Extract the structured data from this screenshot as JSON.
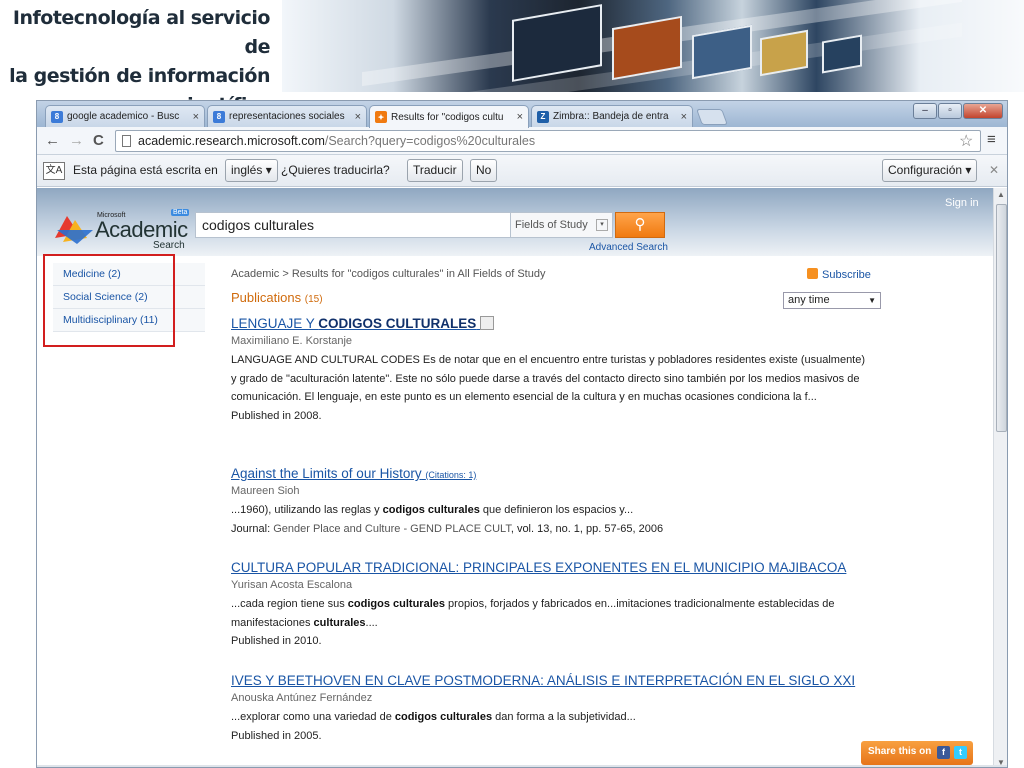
{
  "slide": {
    "title_line1": "Infotecnología al servicio de",
    "title_line2": "la gestión de información",
    "title_line3": "científica"
  },
  "browser": {
    "tabs": [
      {
        "label": "google academico - Busc",
        "icon": "google-favicon",
        "color": "#3c7bd8"
      },
      {
        "label": "representaciones sociales",
        "icon": "google-favicon",
        "color": "#3c7bd8"
      },
      {
        "label": "Results for \"codigos cultu",
        "icon": "academic-favicon",
        "color": "#f07a10"
      },
      {
        "label": "Zimbra:: Bandeja de entra",
        "icon": "zimbra-favicon",
        "color": "#1f5fa8"
      }
    ],
    "url_host": "academic.research.microsoft.com",
    "url_path": "/Search?query=codigos%20culturales"
  },
  "translate_bar": {
    "prefix": "Esta página está escrita en",
    "language": "inglés",
    "question": "¿Quieres traducirla?",
    "translate_button": "Traducir",
    "no_button": "No",
    "settings_button": "Configuración",
    "icon_text": "文A"
  },
  "site": {
    "sign_in": "Sign in",
    "logo_microsoft": "Microsoft",
    "logo_academic": "Academic",
    "logo_search": "Search",
    "logo_beta": "Beta",
    "search_value": "codigos culturales",
    "fields_label": "Fields of Study",
    "go_icon": "⚲",
    "advanced_search": "Advanced Search"
  },
  "leftnav": [
    {
      "label": "Medicine (2)"
    },
    {
      "label": "Social Science (2)"
    },
    {
      "label": "Multidisciplinary (11)"
    }
  ],
  "main": {
    "breadcrumb_root": "Academic",
    "breadcrumb_sep": ">",
    "breadcrumb_text": "Results for \"codigos culturales\" in All Fields of Study",
    "subscribe": "Subscribe",
    "publications_label": "Publications",
    "publications_count": "(15)",
    "time_filter": "any time"
  },
  "results": [
    {
      "title_a": "LENGUAJE Y ",
      "title_b": "CODIGOS CULTURALES",
      "author": "Maximiliano E. Korstanje",
      "snippet": "LANGUAGE AND CULTURAL CODES Es de notar que en el encuentro entre turistas y pobladores residentes existe (usualmente) y grado de \"aculturación latente\". Este no sólo puede darse a través del contacto directo sino también por los medios masivos de comunicación. El lenguaje, en este punto es un elemento esencial de la cultura y en muchas ocasiones condiciona la f...",
      "published": "Published in 2008."
    },
    {
      "title": "Against the Limits of our History",
      "citations": "(Citations: 1)",
      "author": "Maureen Sioh",
      "snippet_a": "...1960), utilizando las reglas y ",
      "snippet_b": "codigos culturales",
      "snippet_c": " que definieron los espacios y...",
      "journal_label": "Journal:",
      "journal_name": "Gender Place and Culture - GEND PLACE CULT",
      "journal_info": ", vol. 13, no. 1, pp. 57-65, 2006"
    },
    {
      "title": "CULTURA POPULAR TRADICIONAL: PRINCIPALES EXPONENTES EN EL MUNICIPIO MAJIBACOA",
      "author": "Yurisan Acosta Escalona",
      "snippet_a": "...cada region tiene sus ",
      "snippet_b": "codigos culturales",
      "snippet_c": " propios, forjados y fabricados en...imitaciones tradicionalmente establecidas de manifestaciones ",
      "snippet_d": "culturales",
      "snippet_e": "....",
      "published": "Published in 2010."
    },
    {
      "title": "IVES Y BEETHOVEN EN CLAVE POSTMODERNA: ANÁLISIS E INTERPRETACIÓN EN EL SIGLO XXI",
      "author": "Anouska Antúnez Fernández",
      "snippet_a": "...explorar como una variedad de ",
      "snippet_b": "codigos culturales",
      "snippet_c": " dan forma a la subjetividad...",
      "published": "Published in 2005."
    }
  ],
  "share": {
    "label": "Share this on",
    "facebook": "f",
    "twitter": "t"
  },
  "colors": {
    "link": "#1a55a5",
    "accent_orange": "#f07a10",
    "highlight_box": "#d21e1e"
  }
}
